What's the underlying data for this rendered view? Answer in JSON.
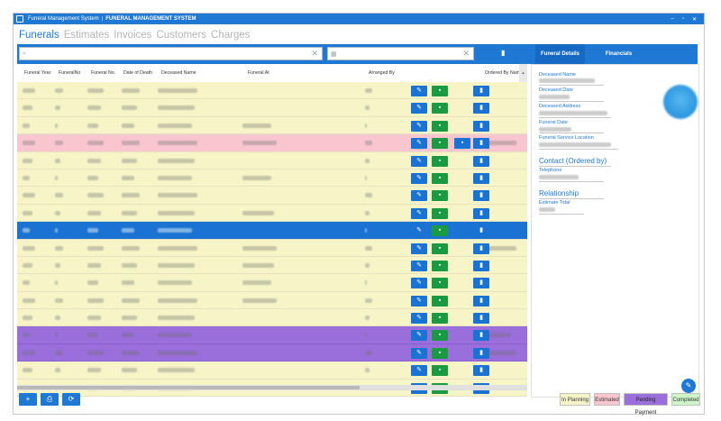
{
  "window": {
    "title_prefix": "Funeral Management System",
    "title_main": "FUNERAL MANAGEMENT SYSTEM",
    "minimize": "–",
    "maximize": "▫",
    "close": "✕"
  },
  "nav_tabs": [
    "Funerals",
    "Estimates",
    "Invoices",
    "Customers",
    "Charges"
  ],
  "search": {
    "icon": "search-icon",
    "clear": "✕",
    "placeholder": ""
  },
  "date_filter": {
    "icon": "calendar-icon",
    "clear": "✕"
  },
  "detail_tabs": [
    "Funeral Details",
    "Financials"
  ],
  "grid": {
    "columns": [
      "Funeral Year",
      "FuneralNo",
      "Funeral No.",
      "Date of Death",
      "Deceased Name",
      "Funeral At",
      "Arranged By",
      "Ordered By Name"
    ],
    "row_status": [
      "planning",
      "planning",
      "planning",
      "estimated",
      "planning",
      "planning",
      "planning",
      "planning",
      "selected",
      "planning",
      "planning",
      "planning",
      "planning",
      "planning",
      "pending",
      "pending",
      "planning",
      "planning"
    ],
    "row_has_doc_button": [
      false,
      false,
      false,
      true,
      false,
      false,
      false,
      false,
      false,
      false,
      false,
      false,
      false,
      false,
      false,
      false,
      false,
      false
    ]
  },
  "detail": {
    "labels": {
      "deceased_name": "Deceased Name",
      "deceased_date": "Deceased Date",
      "deceased_address": "Deceased Address",
      "funeral_date": "Funeral Date",
      "funeral_service_location": "Funeral Service Location",
      "contact_section": "Contact (Ordered by)",
      "telephone": "Telephone",
      "relationship_section": "Relationship",
      "estimate_total": "Estimate Total"
    }
  },
  "legend": {
    "in_planning": "In Planning",
    "estimated": "Estimated",
    "pending_payment": "Pending Payment",
    "completed": "Completed"
  },
  "colors": {
    "accent": "#1e78d4",
    "planning": "#f7f5c7",
    "estimated": "#f9c6cf",
    "pending": "#9b6fdb",
    "selected": "#1a73d2",
    "completed": "#cdf5c8"
  },
  "bottom_buttons": {
    "add": "+",
    "print": "⎙",
    "refresh": "⟳"
  }
}
